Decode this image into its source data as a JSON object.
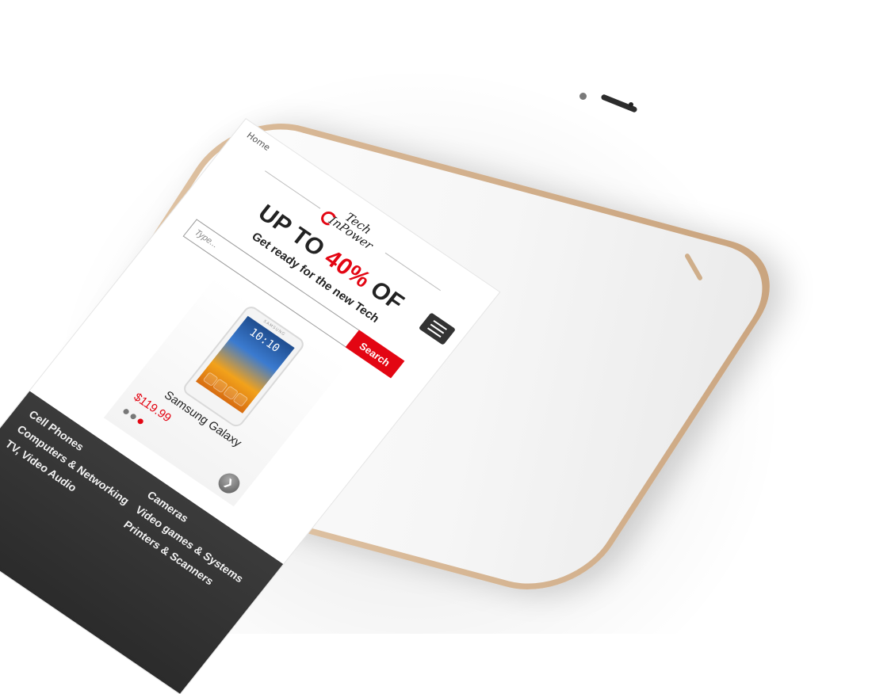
{
  "screen": {
    "breadcrumb": "Home",
    "logo": {
      "line1": "Tech",
      "line2": "InPower"
    },
    "hero": {
      "headline_prefix": "UP TO ",
      "headline_accent": "40%",
      "headline_suffix": " OF",
      "subline": "Get ready for the new Tech"
    },
    "search": {
      "placeholder": "Type...",
      "button_label": "Search"
    },
    "product": {
      "brand": "SAMSUNG",
      "clock": "10:10",
      "name": "Samsung Galaxy",
      "price": "$119.99",
      "next_icon": "chevron-right-icon"
    },
    "carousel": {
      "count": 3,
      "active_index": 2
    },
    "categories": [
      "Cell Phones",
      "Cameras",
      "Computers & Networking",
      "Video games & Systems",
      "TV, Video Audio",
      "Printers & Scanners"
    ],
    "menu_icon": "hamburger-icon"
  },
  "colors": {
    "accent": "#e30613",
    "footer": "#333333",
    "phone_frame": "#d8b896"
  }
}
